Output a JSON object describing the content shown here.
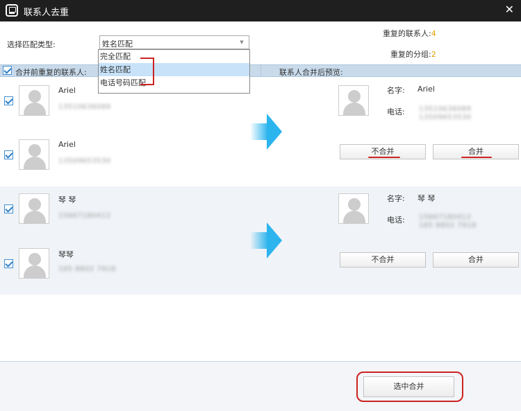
{
  "window": {
    "title": "联系人去重",
    "app_icon": "phone-book-icon",
    "close_glyph": "✕"
  },
  "match_type": {
    "label": "选择匹配类型:",
    "selected": "姓名匹配",
    "options": [
      "完全匹配",
      "姓名匹配",
      "电话号码匹配"
    ]
  },
  "stats": {
    "dup_contacts_label": "重复的联系人:",
    "dup_contacts_count": "4",
    "dup_groups_label": "重复的分组:",
    "dup_groups_count": "2"
  },
  "columns": {
    "left": "合并前重复的联系人:",
    "right": "联系人合并后预览:"
  },
  "groups": [
    {
      "contacts": [
        {
          "name": "Ariel",
          "phone": "13510636089"
        },
        {
          "name": "Ariel",
          "phone": "13509653530"
        }
      ],
      "preview": {
        "name_label": "名字:",
        "name": "Ariel",
        "phone_label": "电话:",
        "phones": [
          "13510636089",
          "13509653530"
        ]
      },
      "btn_no_merge": "不合并",
      "btn_merge": "合并"
    },
    {
      "contacts": [
        {
          "name": "琴 琴",
          "phone": "15667180412"
        },
        {
          "name": "琴琴",
          "phone": "185 8802 7918"
        }
      ],
      "preview": {
        "name_label": "名字:",
        "name": "琴 琴",
        "phone_label": "电话:",
        "phones": [
          "15667180412",
          "185 8802 7918"
        ]
      },
      "btn_no_merge": "不合并",
      "btn_merge": "合并"
    }
  ],
  "footer": {
    "merge_selected": "选中合并"
  },
  "colors": {
    "accent_count": "#e8a000",
    "annotation_red": "#cc2222",
    "header_bar": "#c9dbeb",
    "arrow": "#2cb4ee"
  }
}
